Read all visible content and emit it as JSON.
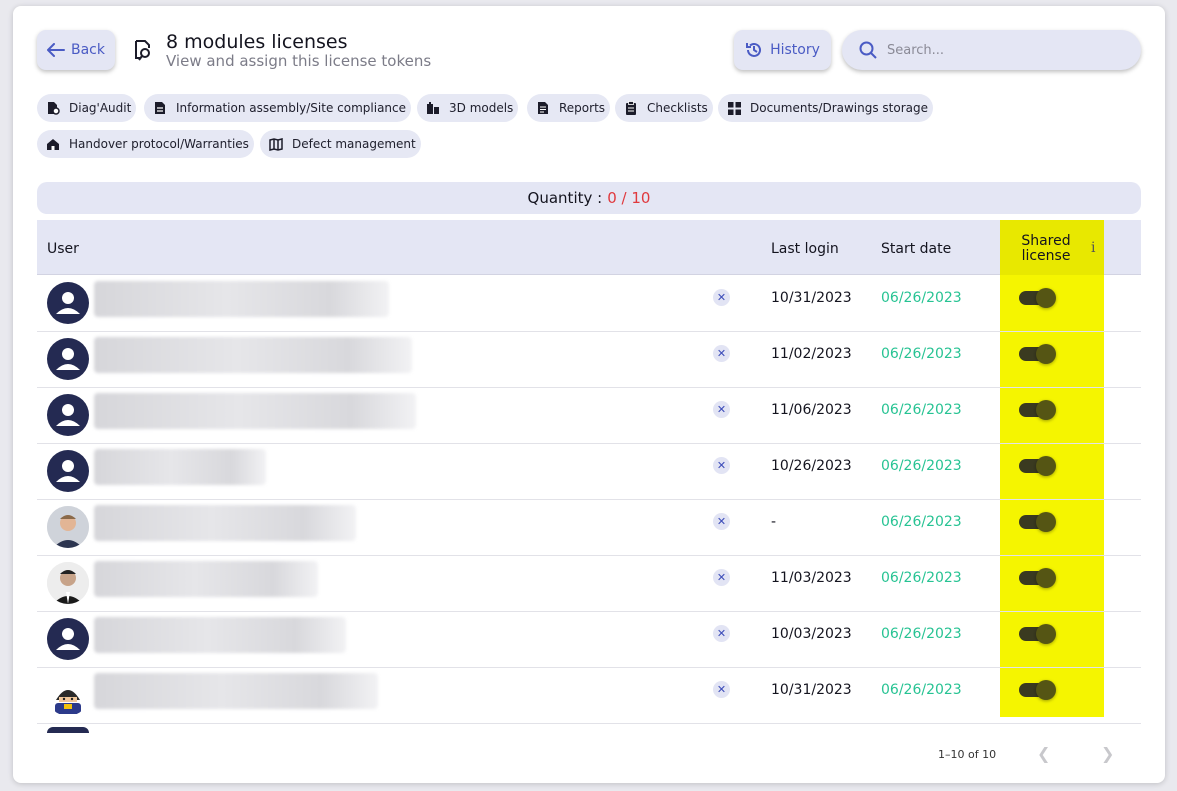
{
  "header": {
    "back_label": "Back",
    "title": "8 modules licenses",
    "subtitle": "View and assign this license tokens",
    "history_label": "History",
    "search_placeholder": "Search..."
  },
  "modules": [
    {
      "label": "Diag'Audit",
      "icon": "diag-audit-icon"
    },
    {
      "label": "Information assembly/Site compliance",
      "icon": "document-icon"
    },
    {
      "label": "3D models",
      "icon": "buildings-icon"
    },
    {
      "label": "Reports",
      "icon": "report-icon"
    },
    {
      "label": "Checklists",
      "icon": "checklist-icon"
    },
    {
      "label": "Documents/Drawings storage",
      "icon": "grid-icon"
    },
    {
      "label": "Handover protocol/Warranties",
      "icon": "house-icon"
    },
    {
      "label": "Defect management",
      "icon": "map-icon"
    }
  ],
  "quantity": {
    "label": "Quantity :",
    "value": "0 / 10"
  },
  "table": {
    "columns": {
      "user": "User",
      "last_login": "Last login",
      "start_date": "Start date",
      "shared": "Shared license",
      "info": "i"
    },
    "rows": [
      {
        "last_login": "10/31/2023",
        "start_date": "06/26/2023",
        "shared": true
      },
      {
        "last_login": "11/02/2023",
        "start_date": "06/26/2023",
        "shared": true
      },
      {
        "last_login": "11/06/2023",
        "start_date": "06/26/2023",
        "shared": true
      },
      {
        "last_login": "10/26/2023",
        "start_date": "06/26/2023",
        "shared": true
      },
      {
        "last_login": "-",
        "start_date": "06/26/2023",
        "shared": true
      },
      {
        "last_login": "11/03/2023",
        "start_date": "06/26/2023",
        "shared": true
      },
      {
        "last_login": "10/03/2023",
        "start_date": "06/26/2023",
        "shared": true
      },
      {
        "last_login": "10/31/2023",
        "start_date": "06/26/2023",
        "shared": true
      }
    ]
  },
  "pagination": {
    "text": "1–10 of 10"
  },
  "colors": {
    "accent": "#4a5bc4",
    "date": "#27c393",
    "quantity_value": "#e0393e",
    "highlight": "#f5f500"
  }
}
